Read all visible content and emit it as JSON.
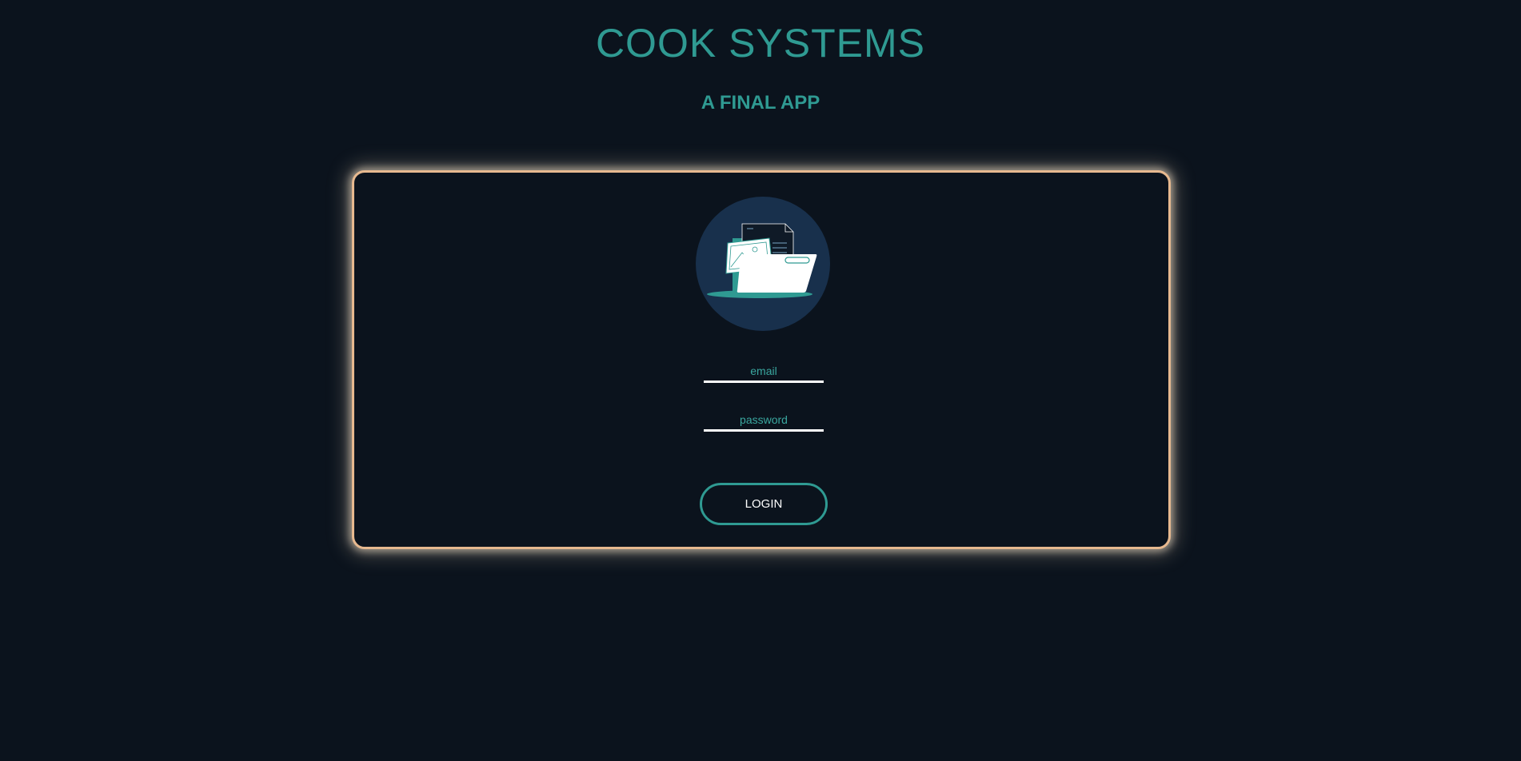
{
  "header": {
    "title": "COOK SYSTEMS",
    "subtitle": "A FINAL APP"
  },
  "login": {
    "avatar_icon": "folder-documents-icon",
    "email_placeholder": "email",
    "email_value": "",
    "password_placeholder": "password",
    "password_value": "",
    "button_label": "LOGIN"
  },
  "colors": {
    "background": "#0b131d",
    "accent": "#2f9a92",
    "card_border": "#e7b98f",
    "avatar_bg": "#18304c"
  }
}
